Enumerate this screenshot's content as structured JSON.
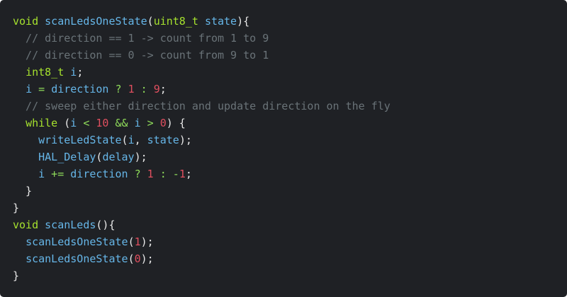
{
  "colors": {
    "background": "#1f2125",
    "keyword": "#a6e22e",
    "identifier": "#66b6e8",
    "punct": "#e8e8e8",
    "comment": "#6a7378",
    "number": "#e04f5f",
    "operator": "#8fdc5a"
  },
  "code": {
    "lines": [
      [
        {
          "t": "void ",
          "c": "keyword"
        },
        {
          "t": "scanLedsOneState",
          "c": "identifier"
        },
        {
          "t": "(",
          "c": "punct"
        },
        {
          "t": "uint8_t",
          "c": "keyword"
        },
        {
          "t": " ",
          "c": "punct"
        },
        {
          "t": "state",
          "c": "identifier"
        },
        {
          "t": "){",
          "c": "punct"
        }
      ],
      [
        {
          "t": "  // direction == 1 -> count from 1 to 9",
          "c": "comment"
        }
      ],
      [
        {
          "t": "  // direction == 0 -> count from 9 to 1",
          "c": "comment"
        }
      ],
      [
        {
          "t": "  ",
          "c": "punct"
        },
        {
          "t": "int8_t",
          "c": "keyword"
        },
        {
          "t": " ",
          "c": "punct"
        },
        {
          "t": "i",
          "c": "identifier"
        },
        {
          "t": ";",
          "c": "punct"
        }
      ],
      [
        {
          "t": "  ",
          "c": "punct"
        },
        {
          "t": "i",
          "c": "identifier"
        },
        {
          "t": " = ",
          "c": "operator"
        },
        {
          "t": "direction",
          "c": "identifier"
        },
        {
          "t": " ? ",
          "c": "operator"
        },
        {
          "t": "1",
          "c": "number"
        },
        {
          "t": " : ",
          "c": "operator"
        },
        {
          "t": "9",
          "c": "number"
        },
        {
          "t": ";",
          "c": "punct"
        }
      ],
      [
        {
          "t": "  // sweep either direction and update direction on the fly",
          "c": "comment"
        }
      ],
      [
        {
          "t": "  ",
          "c": "punct"
        },
        {
          "t": "while",
          "c": "keyword"
        },
        {
          "t": " (",
          "c": "punct"
        },
        {
          "t": "i",
          "c": "identifier"
        },
        {
          "t": " < ",
          "c": "operator"
        },
        {
          "t": "10",
          "c": "number"
        },
        {
          "t": " && ",
          "c": "operator"
        },
        {
          "t": "i",
          "c": "identifier"
        },
        {
          "t": " > ",
          "c": "operator"
        },
        {
          "t": "0",
          "c": "number"
        },
        {
          "t": ") {",
          "c": "punct"
        }
      ],
      [
        {
          "t": "    ",
          "c": "punct"
        },
        {
          "t": "writeLedState",
          "c": "identifier"
        },
        {
          "t": "(",
          "c": "punct"
        },
        {
          "t": "i",
          "c": "identifier"
        },
        {
          "t": ", ",
          "c": "punct"
        },
        {
          "t": "state",
          "c": "identifier"
        },
        {
          "t": ");",
          "c": "punct"
        }
      ],
      [
        {
          "t": "    ",
          "c": "punct"
        },
        {
          "t": "HAL_Delay",
          "c": "identifier"
        },
        {
          "t": "(",
          "c": "punct"
        },
        {
          "t": "delay",
          "c": "identifier"
        },
        {
          "t": ");",
          "c": "punct"
        }
      ],
      [
        {
          "t": "    ",
          "c": "punct"
        },
        {
          "t": "i",
          "c": "identifier"
        },
        {
          "t": " += ",
          "c": "operator"
        },
        {
          "t": "direction",
          "c": "identifier"
        },
        {
          "t": " ? ",
          "c": "operator"
        },
        {
          "t": "1",
          "c": "number"
        },
        {
          "t": " : ",
          "c": "operator"
        },
        {
          "t": "-",
          "c": "operator"
        },
        {
          "t": "1",
          "c": "number"
        },
        {
          "t": ";",
          "c": "punct"
        }
      ],
      [
        {
          "t": "  }",
          "c": "punct"
        }
      ],
      [
        {
          "t": "}",
          "c": "punct"
        }
      ],
      [
        {
          "t": "void ",
          "c": "keyword"
        },
        {
          "t": "scanLeds",
          "c": "identifier"
        },
        {
          "t": "(){",
          "c": "punct"
        }
      ],
      [
        {
          "t": "  ",
          "c": "punct"
        },
        {
          "t": "scanLedsOneState",
          "c": "identifier"
        },
        {
          "t": "(",
          "c": "punct"
        },
        {
          "t": "1",
          "c": "number"
        },
        {
          "t": ");",
          "c": "punct"
        }
      ],
      [
        {
          "t": "  ",
          "c": "punct"
        },
        {
          "t": "scanLedsOneState",
          "c": "identifier"
        },
        {
          "t": "(",
          "c": "punct"
        },
        {
          "t": "0",
          "c": "number"
        },
        {
          "t": ");",
          "c": "punct"
        }
      ],
      [
        {
          "t": "}",
          "c": "punct"
        }
      ]
    ]
  }
}
